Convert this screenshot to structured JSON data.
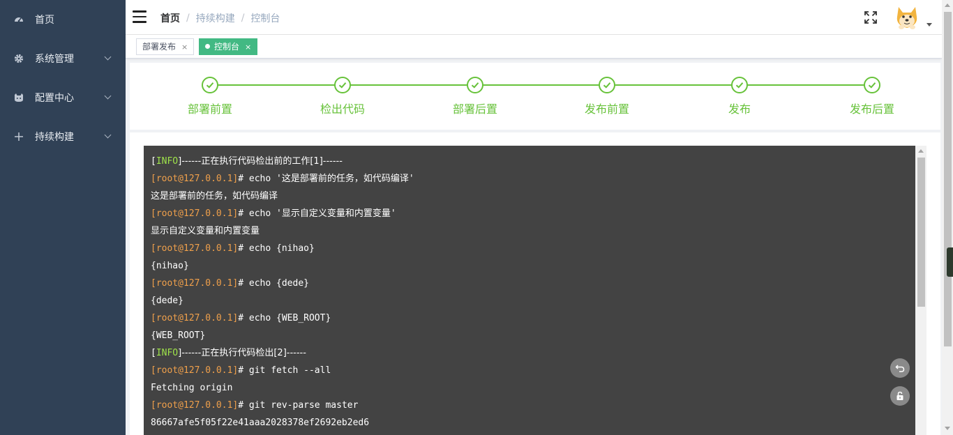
{
  "sidebar": {
    "items": [
      {
        "label": "首页",
        "icon": "dashboard-icon"
      },
      {
        "label": "系统管理",
        "icon": "gear-icon"
      },
      {
        "label": "配置中心",
        "icon": "cat-icon"
      },
      {
        "label": "持续构建",
        "icon": "plus-icon"
      }
    ]
  },
  "header": {
    "breadcrumb": [
      "首页",
      "持续构建",
      "控制台"
    ]
  },
  "tags": [
    {
      "label": "部署发布",
      "close": "×"
    },
    {
      "label": "控制台",
      "close": "×"
    }
  ],
  "steps": [
    "部署前置",
    "检出代码",
    "部署后置",
    "发布前置",
    "发布",
    "发布后置"
  ],
  "console": {
    "lines": [
      {
        "type": "info",
        "pre": "[",
        "tag": "INFO",
        "post": "]------正在执行代码检出前的工作[1]------"
      },
      {
        "type": "cmd",
        "prompt": "[root@127.0.0.1]",
        "cmd": "# echo '这是部署前的任务，如代码编译'"
      },
      {
        "type": "out",
        "text": "这是部署前的任务，如代码编译"
      },
      {
        "type": "cmd",
        "prompt": "[root@127.0.0.1]",
        "cmd": "# echo '显示自定义变量和内置变量'"
      },
      {
        "type": "out",
        "text": "显示自定义变量和内置变量"
      },
      {
        "type": "cmd",
        "prompt": "[root@127.0.0.1]",
        "cmd": "# echo {nihao}"
      },
      {
        "type": "out",
        "text": "{nihao}"
      },
      {
        "type": "cmd",
        "prompt": "[root@127.0.0.1]",
        "cmd": "# echo {dede}"
      },
      {
        "type": "out",
        "text": "{dede}"
      },
      {
        "type": "cmd",
        "prompt": "[root@127.0.0.1]",
        "cmd": "# echo {WEB_ROOT}"
      },
      {
        "type": "out",
        "text": "{WEB_ROOT}"
      },
      {
        "type": "info",
        "pre": "[",
        "tag": "INFO",
        "post": "]------正在执行代码检出[2]------"
      },
      {
        "type": "cmd",
        "prompt": "[root@127.0.0.1]",
        "cmd": "# git fetch --all"
      },
      {
        "type": "out",
        "text": "Fetching origin"
      },
      {
        "type": "cmd",
        "prompt": "[root@127.0.0.1]",
        "cmd": "# git rev-parse master"
      },
      {
        "type": "out",
        "text": "86667afe5f05f22e41aaa2028378ef2692eb2ed6"
      }
    ]
  },
  "colors": {
    "sidebar_bg": "#304156",
    "accent": "#42b983",
    "step_green": "#67c23a",
    "console_bg": "#434343",
    "info_green": "#9fe34a",
    "prompt_orange": "#f0a04b"
  }
}
